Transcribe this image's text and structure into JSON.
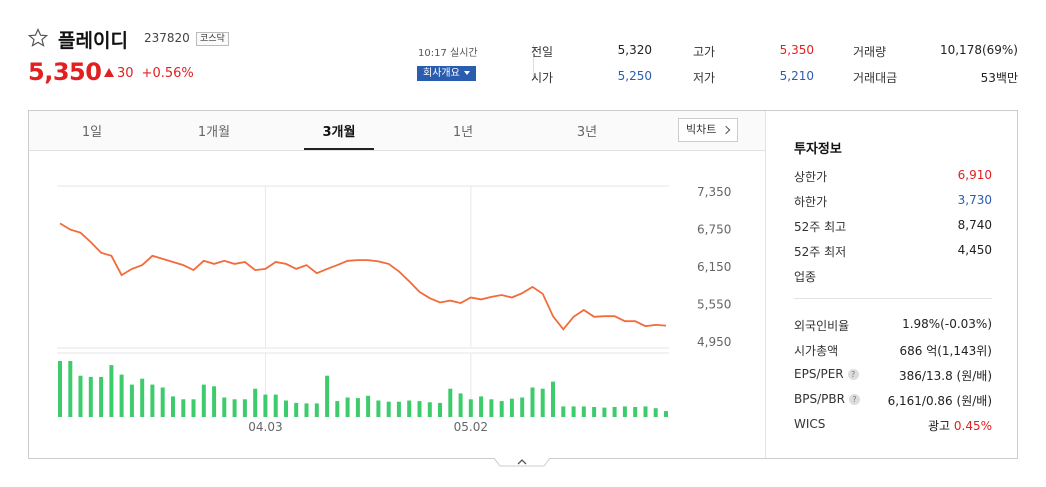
{
  "stock": {
    "name": "플레이디",
    "code": "237820",
    "market": "코스닥",
    "price": "5,350",
    "change": "30",
    "change_pct": "+0.56%",
    "time": "10:17 실시간",
    "company_btn": "회사개요"
  },
  "quotes": [
    {
      "label": "전일",
      "value": "5,320"
    },
    {
      "label": "고가",
      "value": "5,350"
    },
    {
      "label": "거래량",
      "value": "10,178(69%)"
    },
    {
      "label": "시가",
      "value": "5,250"
    },
    {
      "label": "저가",
      "value": "5,210"
    },
    {
      "label": "거래대금",
      "value": "53백만"
    }
  ],
  "tabs": [
    "1일",
    "1개월",
    "3개월",
    "1년",
    "3년"
  ],
  "active_tab": "3개월",
  "big_chart_btn": "빅차트",
  "invest": {
    "title": "투자정보",
    "rows": [
      {
        "label": "상한가",
        "value": "6,910"
      },
      {
        "label": "하한가",
        "value": "3,730"
      },
      {
        "label": "52주 최고",
        "value": "8,740"
      },
      {
        "label": "52주 최저",
        "value": "4,450"
      },
      {
        "label": "업종",
        "value": ""
      }
    ],
    "rows2": [
      {
        "label": "외국인비율",
        "value": "1.98%(-0.03%)"
      },
      {
        "label": "시가총액",
        "value": "686 억(1,143위)"
      },
      {
        "label": "EPS/PER",
        "value": "386/13.8 (원/배)"
      },
      {
        "label": "BPS/PBR",
        "value": "6,161/0.86 (원/배)"
      },
      {
        "label": "WICS",
        "value": "광고",
        "extra": "0.45%"
      }
    ]
  },
  "colors": {
    "up": "#e22020",
    "down": "#2a5db0",
    "line": "#f26b3a",
    "volume": "#3ecb6b"
  },
  "chart_data": {
    "type": "line",
    "y_ticks": [
      "7,350",
      "6,750",
      "6,150",
      "5,550",
      "4,950"
    ],
    "ylim": [
      4850,
      7450
    ],
    "x_ticks": [
      "04.03",
      "05.02"
    ],
    "x_tick_index": [
      20,
      40
    ],
    "prices": [
      6850,
      6750,
      6700,
      6550,
      6380,
      6330,
      6020,
      6120,
      6180,
      6330,
      6280,
      6230,
      6180,
      6100,
      6250,
      6200,
      6250,
      6200,
      6230,
      6100,
      6120,
      6230,
      6200,
      6120,
      6180,
      6050,
      6120,
      6180,
      6250,
      6260,
      6260,
      6240,
      6200,
      6080,
      5920,
      5750,
      5650,
      5580,
      5610,
      5570,
      5660,
      5630,
      5670,
      5700,
      5660,
      5730,
      5830,
      5720,
      5360,
      5150,
      5350,
      5460,
      5350,
      5360,
      5360,
      5280,
      5280,
      5200,
      5220,
      5210
    ],
    "volumes": [
      95,
      95,
      70,
      68,
      68,
      88,
      72,
      55,
      65,
      55,
      50,
      35,
      30,
      30,
      55,
      52,
      33,
      30,
      30,
      48,
      38,
      38,
      28,
      24,
      23,
      23,
      70,
      27,
      33,
      32,
      36,
      28,
      26,
      26,
      28,
      27,
      25,
      24,
      48,
      40,
      30,
      35,
      30,
      27,
      31,
      33,
      50,
      48,
      60,
      18,
      18,
      18,
      17,
      16,
      17,
      18,
      17,
      18,
      15,
      10
    ]
  },
  "toggle_icon": "chevron-up-icon"
}
